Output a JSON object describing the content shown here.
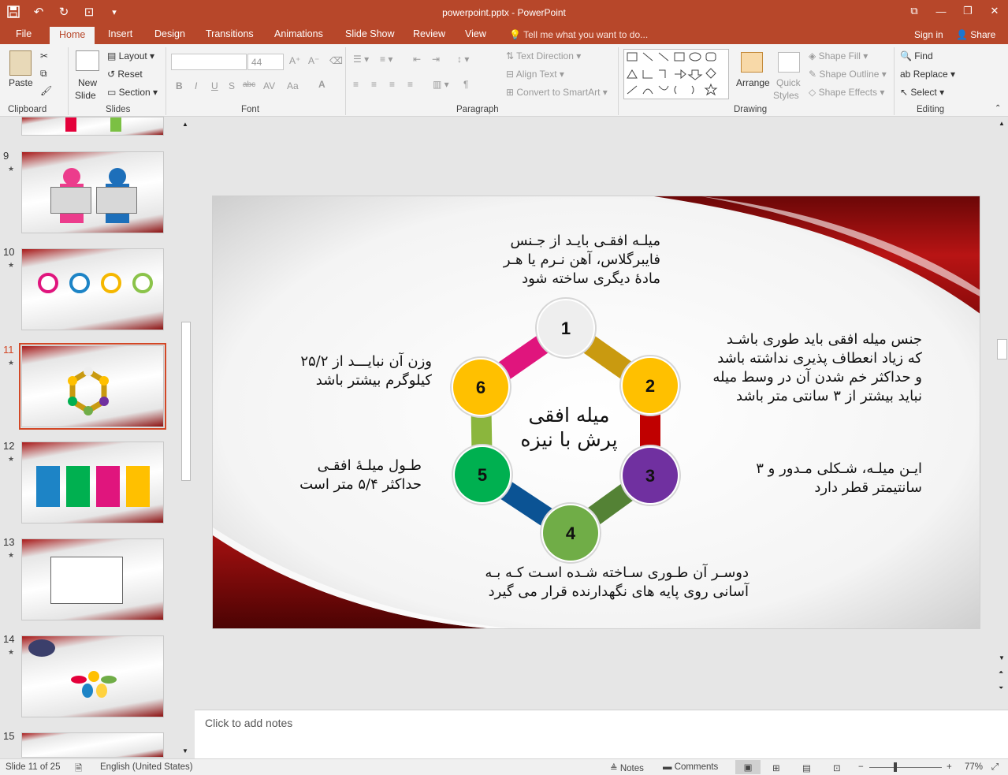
{
  "window": {
    "title": "powerpoint.pptx - PowerPoint",
    "controls": {
      "restore_down": "⧉",
      "minimize": "—",
      "maximize": "❐",
      "close": "✕"
    }
  },
  "quick_access": {
    "save_icon": "💾",
    "undo_icon": "↶",
    "redo_icon": "↻",
    "present_icon": "⊡",
    "customize_icon": "▾"
  },
  "tabs": [
    "File",
    "Home",
    "Insert",
    "Design",
    "Transitions",
    "Animations",
    "Slide Show",
    "Review",
    "View"
  ],
  "active_tab": "Home",
  "tell_me": "Tell me what you want to do...",
  "sign_in": "Sign in",
  "share": "Share",
  "ribbon": {
    "clipboard": {
      "label": "Clipboard",
      "paste": "Paste"
    },
    "slides": {
      "label": "Slides",
      "new_slide": "New",
      "new_slide2": "Slide",
      "layout": "Layout",
      "reset": "Reset",
      "section": "Section"
    },
    "font": {
      "label": "Font",
      "font_name": "",
      "font_size": "44",
      "bold": "B",
      "italic": "I",
      "underline": "U",
      "shadow": "S",
      "strike": "abc",
      "spacing": "AV",
      "case": "Aa"
    },
    "paragraph": {
      "label": "Paragraph",
      "text_direction": "Text Direction",
      "align_text": "Align Text",
      "convert": "Convert to SmartArt"
    },
    "drawing": {
      "label": "Drawing",
      "arrange": "Arrange",
      "quick_styles": "Quick",
      "quick_styles2": "Styles",
      "shape_fill": "Shape Fill",
      "shape_outline": "Shape Outline",
      "shape_effects": "Shape Effects"
    },
    "editing": {
      "label": "Editing",
      "find": "Find",
      "replace": "Replace",
      "select": "Select"
    }
  },
  "thumbnails": [
    {
      "num": "9"
    },
    {
      "num": "10"
    },
    {
      "num": "11"
    },
    {
      "num": "12"
    },
    {
      "num": "13"
    },
    {
      "num": "14"
    },
    {
      "num": "15"
    }
  ],
  "slide": {
    "center": [
      "میله افقی",
      "پرش با نیزه"
    ],
    "nodes": [
      "1",
      "2",
      "3",
      "4",
      "5",
      "6"
    ],
    "texts": {
      "top": [
        "میلـه افقـی بایـد از جـنس",
        "فایبرگلاس، آهن نـرم یا هـر",
        "مادهٔ دیگری ساخته شود"
      ],
      "right_top": [
        "جنس میله افقی باید طوری باشـد",
        "که زیاد انعطاف پذیری نداشته باشد",
        "و حداکثر خم شدن آن در وسط میله",
        "نباید بیشتر از ۳ سانتی متر باشد"
      ],
      "right_bottom": [
        "ایـن میلـه، شـکلی مـدور و ۳",
        "سانتیمتر قطر دارد"
      ],
      "bottom": [
        "دوسـر آن طـوری سـاخته شـده اسـت کـه بـه",
        "آسانی روی پایه های نگهدارنده قرار می گیرد"
      ],
      "left_bottom": [
        "طـول میلـهٔ افقـی",
        "حداکثر ۵/۴ متر است"
      ],
      "left_top": [
        "وزن آن نبایـــد از ۲۵/۲",
        "کیلوگرم بیشتر باشد"
      ]
    },
    "colors": {
      "node1": "#eeeeee",
      "node2": "#ffc000",
      "node3": "#7030a0",
      "node4": "#70ad47",
      "node5": "#00b050",
      "node6": "#ffc000",
      "arm12": "#c99a10",
      "arm23": "#c00000",
      "arm34": "#548235",
      "arm45": "#0b5394",
      "arm56": "#8bb63d",
      "arm61": "#e0157d"
    }
  },
  "notes_placeholder": "Click to add notes",
  "status": {
    "slide": "Slide 11 of 25",
    "language": "English (United States)",
    "notes": "Notes",
    "comments": "Comments",
    "zoom": "77%"
  }
}
